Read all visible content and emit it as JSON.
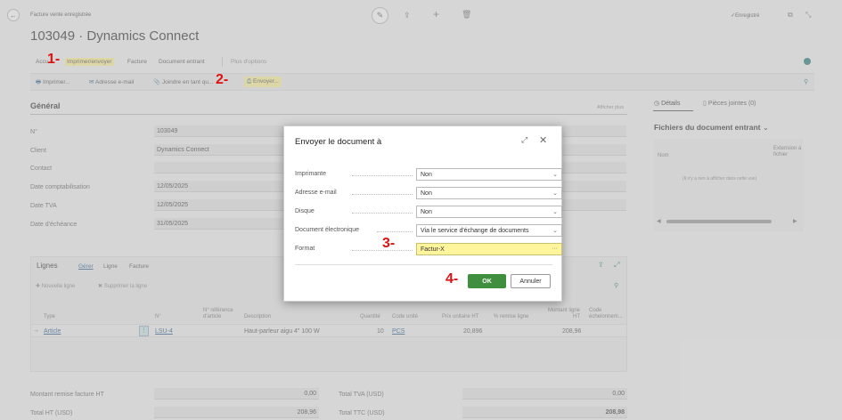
{
  "header": {
    "breadcrumb": "Facture vente enregistrée",
    "title": "103049 · Dynamics Connect",
    "saved_status": "✓Enregistré"
  },
  "menu": {
    "items": [
      "Accu",
      "Imprimer/envoyer",
      "Facture",
      "Document entrant",
      "Plus d'options"
    ]
  },
  "toolbar": {
    "print": "Imprimer...",
    "email": "Adresse e-mail",
    "attach": "Joindre en tant qu...",
    "send": "Envoyer..."
  },
  "general": {
    "title": "Général",
    "show_more": "Afficher plus",
    "fields": [
      {
        "label": "N°",
        "value": "103049"
      },
      {
        "label": "Client",
        "value": "Dynamics Connect"
      },
      {
        "label": "Contact",
        "value": ""
      },
      {
        "label": "Date comptabilisation",
        "value": "12/05/2025"
      },
      {
        "label": "Date TVA",
        "value": "12/05/2025"
      },
      {
        "label": "Date d'échéance",
        "value": "31/05/2025"
      }
    ]
  },
  "lines": {
    "title": "Lignes",
    "tabs": [
      "Gérer",
      "Ligne",
      "Facture"
    ],
    "new_line": "Nouvelle ligne",
    "delete_line": "Supprimer la ligne",
    "columns": [
      "Type",
      "N°",
      "N° référence d'article",
      "Description",
      "Quantité",
      "Code unité",
      "Prix unitaire HT",
      "% remise ligne",
      "Montant ligne HT",
      "Code échelonnem..."
    ],
    "row": {
      "type": "Article",
      "no": "LSU-4",
      "description": "Haut-parleur aigu 4\" 100 W",
      "quantity": "10",
      "unit": "PCS",
      "unit_price": "20,896",
      "amount": "208,96"
    }
  },
  "totals": {
    "discount_label": "Montant remise facture HT",
    "discount_value": "0,00",
    "total_ht_label": "Total HT (USD)",
    "total_ht_value": "208,96",
    "total_tva_label": "Total TVA (USD)",
    "total_tva_value": "0,00",
    "total_ttc_label": "Total TTC (USD)",
    "total_ttc_value": "208,98"
  },
  "factbox": {
    "tab_details": "Détails",
    "tab_attachments": "Pièces jointes (0)",
    "title": "Fichiers du document entrant",
    "col_name": "Nom",
    "col_ext": "Extension à fichier",
    "empty": "(Il n'y a rien à afficher dans cette vue)"
  },
  "dialog": {
    "title": "Envoyer le document à",
    "rows": [
      {
        "label": "Imprimante",
        "value": "Non"
      },
      {
        "label": "Adresse e-mail",
        "value": "Non"
      },
      {
        "label": "Disque",
        "value": "Non"
      },
      {
        "label": "Document électronique",
        "value": "Via le service d'échange de documents"
      },
      {
        "label": "Format",
        "value": "Factur-X"
      }
    ],
    "ok": "OK",
    "cancel": "Annuler"
  },
  "markers": {
    "m1": "1-",
    "m2": "2-",
    "m3": "3-",
    "m4": "4-"
  },
  "colors": {
    "ok_green": "#3f8f3f",
    "highlight": "#fff59d",
    "marker_red": "#e01010"
  }
}
